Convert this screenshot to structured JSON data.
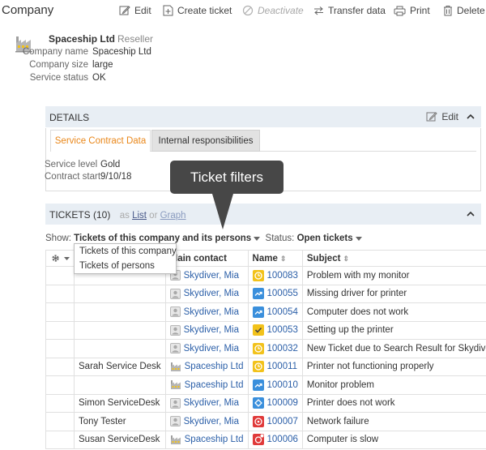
{
  "header": {
    "title": "Company",
    "actions": [
      {
        "label": "Edit",
        "icon": "edit-icon"
      },
      {
        "label": "Create ticket",
        "icon": "create-ticket-icon"
      },
      {
        "label": "Deactivate",
        "icon": "deactivate-icon",
        "disabled": true
      },
      {
        "label": "Transfer data",
        "icon": "transfer-icon"
      },
      {
        "label": "Print",
        "icon": "print-icon"
      },
      {
        "label": "Delete",
        "icon": "trash-icon"
      }
    ]
  },
  "company": {
    "name": "Spaceship Ltd",
    "type": "Reseller",
    "fields": [
      {
        "label": "Company name",
        "value": "Spaceship Ltd"
      },
      {
        "label": "Company size",
        "value": "large"
      },
      {
        "label": "Service status",
        "value": "OK"
      }
    ]
  },
  "details": {
    "title": "DETAILS",
    "edit_label": "Edit",
    "tabs": [
      "Service Contract Data",
      "Internal responsibilities"
    ],
    "fields": [
      {
        "label": "Service level",
        "value": "Gold"
      },
      {
        "label": "Contract start",
        "value": "9/10/18"
      }
    ]
  },
  "tooltip": "Ticket filters",
  "tickets": {
    "title": "TICKETS (10)",
    "as_label": "as",
    "list_label": "List",
    "or_label": "or",
    "graph_label": "Graph",
    "show_label": "Show:",
    "show_value": "Tickets of this company and its persons",
    "status_label": "Status:",
    "status_value": "Open tickets",
    "menu_options": [
      "Tickets of this company",
      "Tickets of persons"
    ],
    "columns": [
      "Main contact",
      "Name",
      "Subject"
    ],
    "rows": [
      {
        "person": "",
        "contact": "Skydiver, Mia",
        "contact_type": "person",
        "status_color": "#f2c21b",
        "status_icon": "waiting",
        "number": "100083",
        "subject": "Problem with my monitor"
      },
      {
        "person": "",
        "contact": "Skydiver, Mia",
        "contact_type": "person",
        "status_color": "#3a8fdc",
        "status_icon": "forwarded",
        "number": "100055",
        "subject": "Missing driver for printer"
      },
      {
        "person": "",
        "contact": "Skydiver, Mia",
        "contact_type": "person",
        "status_color": "#3a8fdc",
        "status_icon": "forwarded",
        "number": "100054",
        "subject": "Computer does not work"
      },
      {
        "person": "",
        "contact": "Skydiver, Mia",
        "contact_type": "person",
        "status_color": "#f2c21b",
        "status_icon": "check",
        "number": "100053",
        "subject": "Setting up the printer"
      },
      {
        "person": "",
        "contact": "Skydiver, Mia",
        "contact_type": "person",
        "status_color": "#f2c21b",
        "status_icon": "waiting",
        "number": "100032",
        "subject": "New Ticket due to Search Result for Skydiver"
      },
      {
        "person": "Sarah Service Desk",
        "contact": "Spaceship Ltd",
        "contact_type": "company",
        "status_color": "#f2c21b",
        "status_icon": "waiting",
        "number": "100011",
        "subject": "Printer not functioning properly"
      },
      {
        "person": "",
        "contact": "Spaceship Ltd",
        "contact_type": "company",
        "status_color": "#3a8fdc",
        "status_icon": "forwarded",
        "number": "100010",
        "subject": "Monitor problem"
      },
      {
        "person": "Simon ServiceDesk",
        "contact": "Skydiver, Mia",
        "contact_type": "person",
        "status_color": "#3a8fdc",
        "status_icon": "diamond",
        "number": "100009",
        "subject": "Printer does not work"
      },
      {
        "person": "Tony Tester",
        "contact": "Skydiver, Mia",
        "contact_type": "person",
        "status_color": "#e03a3a",
        "status_icon": "alarm",
        "number": "100007",
        "subject": "Network failure"
      },
      {
        "person": "Susan ServiceDesk",
        "contact": "Spaceship Ltd",
        "contact_type": "company",
        "status_color": "#e03a3a",
        "status_icon": "alarm-new",
        "number": "100006",
        "subject": "Computer is slow"
      }
    ]
  }
}
